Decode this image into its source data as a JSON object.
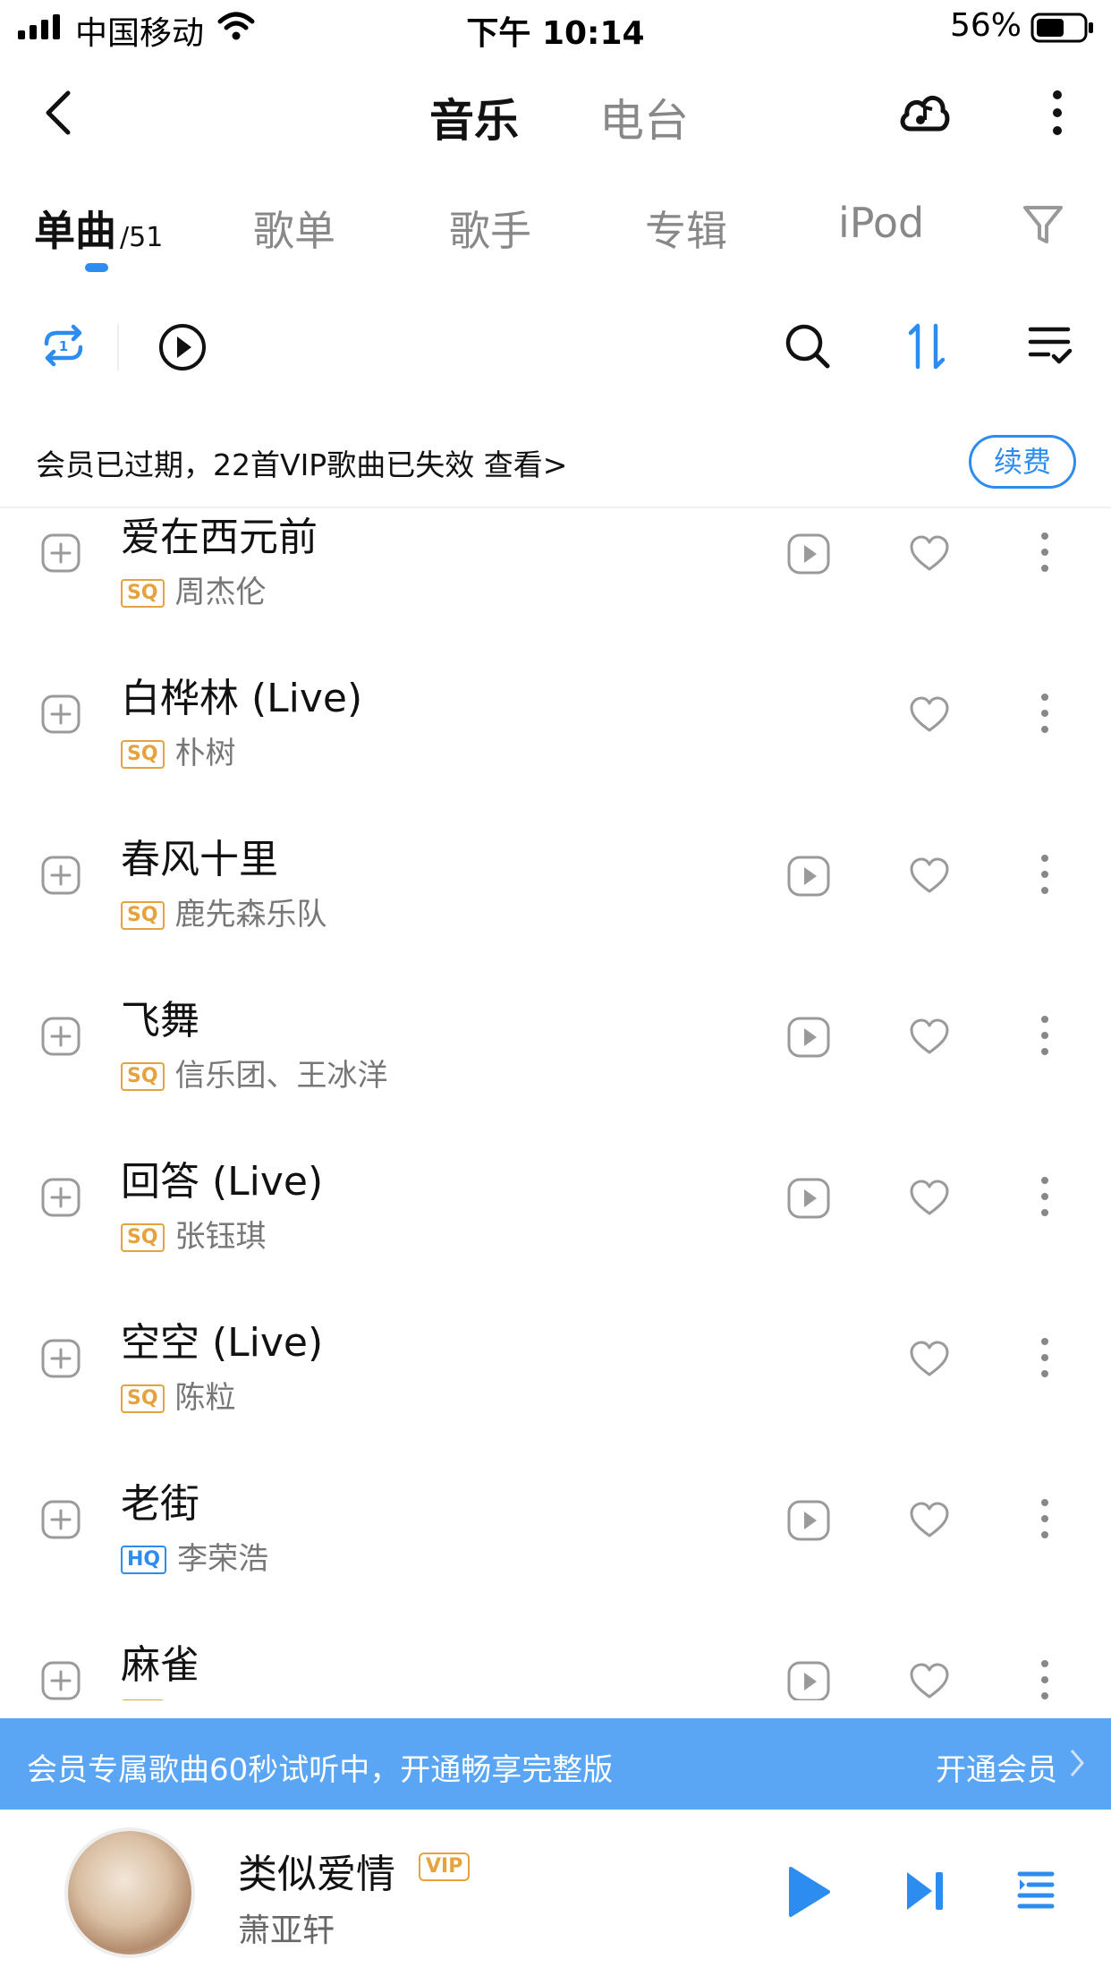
{
  "status_bar": {
    "carrier": "中国移动",
    "time": "下午 10:14",
    "battery": "56%"
  },
  "header": {
    "title_music": "音乐",
    "title_radio": "电台"
  },
  "tabs": [
    {
      "label": "单曲",
      "count": "/51",
      "active": true
    },
    {
      "label": "歌单"
    },
    {
      "label": "歌手"
    },
    {
      "label": "专辑"
    },
    {
      "label": "iPod"
    }
  ],
  "notice": {
    "text": "会员已过期，22首VIP歌曲已失效 查看>",
    "button": "续费"
  },
  "songs": [
    {
      "title": "爱在西元前",
      "quality": "SQ",
      "artist": "周杰伦",
      "has_play": true
    },
    {
      "title": "白桦林 (Live)",
      "quality": "SQ",
      "artist": "朴树",
      "has_play": false
    },
    {
      "title": "春风十里",
      "quality": "SQ",
      "artist": "鹿先森乐队",
      "has_play": true
    },
    {
      "title": "飞舞",
      "quality": "SQ",
      "artist": "信乐团、王冰洋",
      "has_play": true
    },
    {
      "title": "回答 (Live)",
      "quality": "SQ",
      "artist": "张钰琪",
      "has_play": true
    },
    {
      "title": "空空 (Live)",
      "quality": "SQ",
      "artist": "陈粒",
      "has_play": false
    },
    {
      "title": "老街",
      "quality": "HQ",
      "artist": "李荣浩",
      "has_play": true
    },
    {
      "title": "麻雀",
      "quality": "SQ",
      "artist": "",
      "has_play": true
    }
  ],
  "trial_banner": {
    "text": "会员专属歌曲60秒试听中，开通畅享完整版",
    "cta": "开通会员"
  },
  "player": {
    "title": "类似爱情",
    "badge": "VIP",
    "artist": "萧亚轩"
  },
  "colors": {
    "accent": "#2d8cf0",
    "sq_badge": "#e6a23c",
    "banner": "#5aa6f5"
  }
}
